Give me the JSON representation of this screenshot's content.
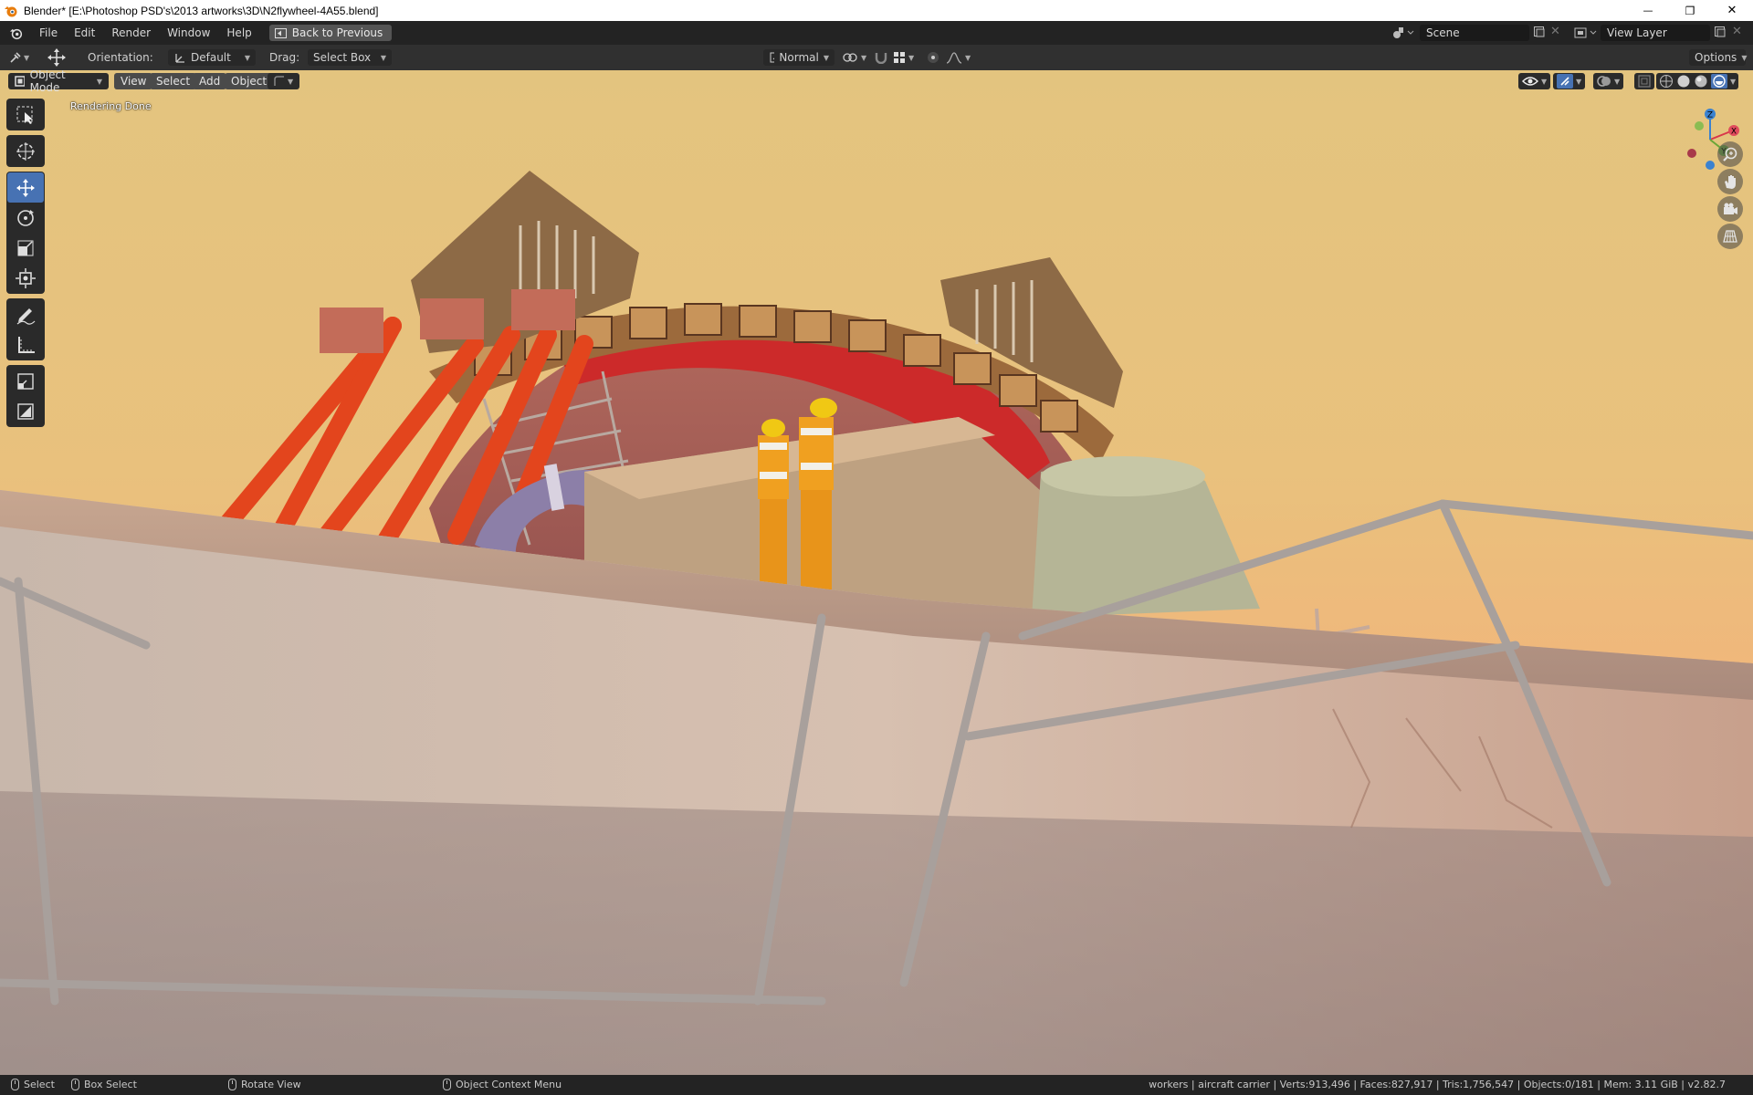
{
  "window": {
    "title": "Blender* [E:\\Photoshop PSD's\\2013 artworks\\3D\\N2flywheel-4A55.blend]",
    "minimize_glyph": "—",
    "maximize_glyph": "❐",
    "close_glyph": "✕"
  },
  "menubar": {
    "items": [
      "File",
      "Edit",
      "Render",
      "Window",
      "Help"
    ],
    "back_button": "Back to Previous",
    "scene": "Scene",
    "view_layer": "View Layer"
  },
  "toolheader": {
    "orientation_label": "Orientation:",
    "orientation_value": "Default",
    "drag_label": "Drag:",
    "drag_value": "Select Box",
    "transform_pivot": "Normal",
    "options": "Options"
  },
  "viewport_header": {
    "mode": "Object Mode",
    "menus": [
      "View",
      "Select",
      "Add",
      "Object"
    ]
  },
  "viewport": {
    "status_text": "Rendering Done",
    "gizmo_axes": {
      "x": "X",
      "y": "Y",
      "z": "Z"
    },
    "colors": {
      "sky_top": "#e3c47f",
      "sky_bottom": "#ef9e84",
      "red_band": "#cc2a2a",
      "red_struts": "#e3451d",
      "worker_vest": "#f0a020",
      "helmet": "#f0c814"
    }
  },
  "toolbar": {
    "tools": [
      "select-box",
      "cursor",
      "move",
      "rotate",
      "scale",
      "transform",
      "annotate",
      "measure",
      "add-cube",
      "extra"
    ],
    "active_tool": "move"
  },
  "statusbar": {
    "select": "Select",
    "box_select": "Box Select",
    "rotate_view": "Rotate View",
    "context_menu": "Object Context Menu",
    "stats": "workers | aircraft carrier | Verts:913,496 | Faces:827,917 | Tris:1,756,547 | Objects:0/181 | Mem: 3.11 GiB | v2.82.7"
  }
}
